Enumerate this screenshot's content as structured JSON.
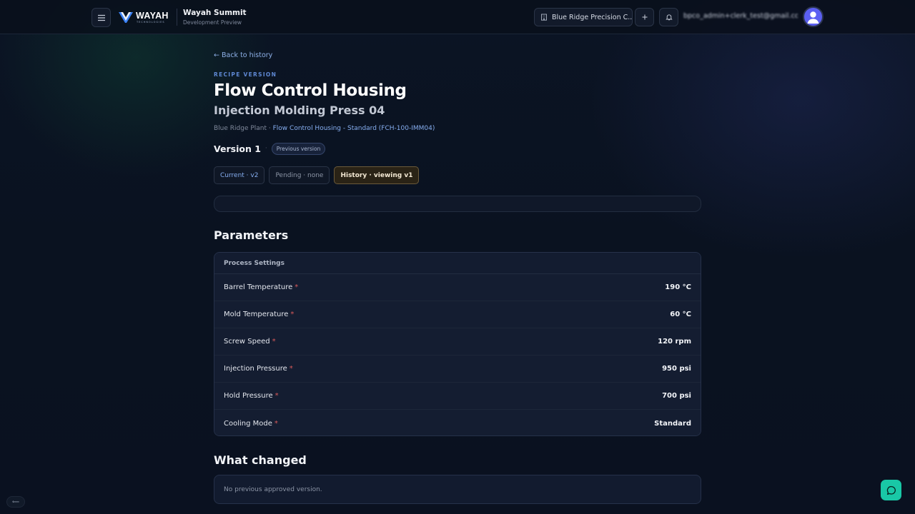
{
  "header": {
    "logo_text": "WAYAH",
    "logo_subtext": "TECHNOLOGIES",
    "app_name": "Wayah Summit",
    "app_subtitle": "Development Preview",
    "plant_selector": "Blue Ridge Precision C...",
    "user_email": "bpco_admin+clerk_test@gmail.com",
    "icons": {
      "menu": "menu-icon",
      "plant": "building-icon",
      "add": "plus-icon",
      "notifications": "bell-icon",
      "avatar": "user-avatar-icon"
    }
  },
  "page": {
    "back_link": "← Back to history",
    "eyebrow": "RECIPE VERSION",
    "title": "Flow Control Housing",
    "subtitle": "Injection Molding Press 04",
    "plant": "Blue Ridge Plant · ",
    "recipe_link": "Flow Control Housing - Standard (FCH-100-IMM04)",
    "version_label": "Version 1",
    "version_separator": "·",
    "previous_badge": "Previous version",
    "tabs": [
      {
        "label": "Current · v2",
        "state": "link"
      },
      {
        "label": "Pending · none",
        "state": "disabled"
      },
      {
        "label": "History · viewing v1",
        "state": "active"
      }
    ]
  },
  "parameters": {
    "section_title": "Parameters",
    "group_title": "Process Settings",
    "required_marker": "*",
    "rows": [
      {
        "name": "Barrel Temperature",
        "value": "190 °C"
      },
      {
        "name": "Mold Temperature",
        "value": "60 °C"
      },
      {
        "name": "Screw Speed",
        "value": "120 rpm"
      },
      {
        "name": "Injection Pressure",
        "value": "950 psi"
      },
      {
        "name": "Hold Pressure",
        "value": "700 psi"
      },
      {
        "name": "Cooling Mode",
        "value": "Standard"
      }
    ]
  },
  "changes": {
    "section_title": "What changed",
    "empty_text": "No previous approved version."
  },
  "floating": {
    "chat_icon": "chat-bubble-icon",
    "dev_toggle": "⟸"
  },
  "colors": {
    "accent": "#86aef0",
    "required": "#d95a5a",
    "chat_button": "#19c8a6",
    "avatar": "#5b5ff2"
  }
}
